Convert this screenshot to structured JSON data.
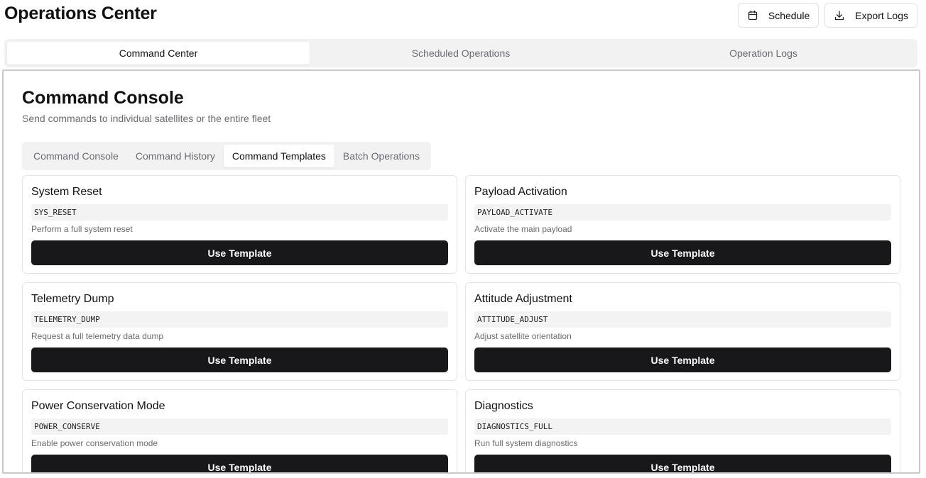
{
  "header": {
    "title": "Operations Center",
    "actions": [
      {
        "label": "Schedule",
        "icon": "calendar-icon"
      },
      {
        "label": "Export Logs",
        "icon": "download-icon"
      }
    ]
  },
  "main_tabs": [
    {
      "label": "Command Center",
      "active": true
    },
    {
      "label": "Scheduled Operations",
      "active": false
    },
    {
      "label": "Operation Logs",
      "active": false
    }
  ],
  "console": {
    "title": "Command Console",
    "subtitle": "Send commands to individual satellites or the entire fleet",
    "tabs": [
      {
        "label": "Command Console",
        "active": false
      },
      {
        "label": "Command History",
        "active": false
      },
      {
        "label": "Command Templates",
        "active": true
      },
      {
        "label": "Batch Operations",
        "active": false
      }
    ]
  },
  "templates": [
    {
      "name": "System Reset",
      "code": "SYS_RESET",
      "description": "Perform a full system reset",
      "button_label": "Use Template"
    },
    {
      "name": "Payload Activation",
      "code": "PAYLOAD_ACTIVATE",
      "description": "Activate the main payload",
      "button_label": "Use Template"
    },
    {
      "name": "Telemetry Dump",
      "code": "TELEMETRY_DUMP",
      "description": "Request a full telemetry data dump",
      "button_label": "Use Template"
    },
    {
      "name": "Attitude Adjustment",
      "code": "ATTITUDE_ADJUST",
      "description": "Adjust satellite orientation",
      "button_label": "Use Template"
    },
    {
      "name": "Power Conservation Mode",
      "code": "POWER_CONSERVE",
      "description": "Enable power conservation mode",
      "button_label": "Use Template"
    },
    {
      "name": "Diagnostics",
      "code": "DIAGNOSTICS_FULL",
      "description": "Run full system diagnostics",
      "button_label": "Use Template"
    }
  ],
  "colors": {
    "primary_button": "#18181b",
    "muted_text": "#6b6b72",
    "tab_background": "#f2f2f3",
    "code_background": "#f3f3f4"
  }
}
